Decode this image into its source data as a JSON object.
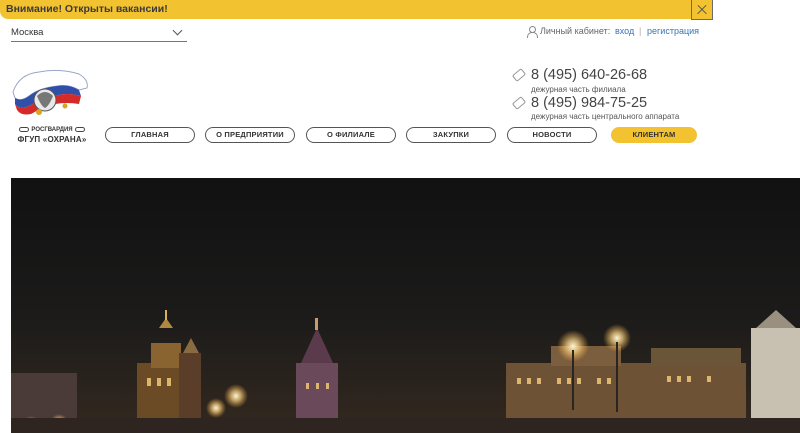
{
  "alert": {
    "text": "Внимание! Открыты вакансии!"
  },
  "city_select": {
    "value": "Москва"
  },
  "account": {
    "label": "Личный кабинет:",
    "login": "вход",
    "separator": "|",
    "register": "регистрация"
  },
  "logo": {
    "line1": "РОСГВАРДИЯ",
    "line2": "ФГУП «ОХРАНА»"
  },
  "phones": [
    {
      "number": "8 (495) 640-26-68",
      "caption": "дежурная часть филиала"
    },
    {
      "number": "8 (495) 984-75-25",
      "caption": "дежурная часть центрального аппарата"
    }
  ],
  "nav": {
    "items": [
      {
        "label": "ГЛАВНАЯ"
      },
      {
        "label": "О ПРЕДПРИЯТИИ"
      },
      {
        "label": "О ФИЛИАЛЕ"
      },
      {
        "label": "ЗАКУПКИ"
      },
      {
        "label": "НОВОСТИ"
      },
      {
        "label": "КЛИЕНТАМ"
      }
    ],
    "active_index": 5
  },
  "colors": {
    "accent": "#f2c230",
    "link": "#3a73b8"
  }
}
